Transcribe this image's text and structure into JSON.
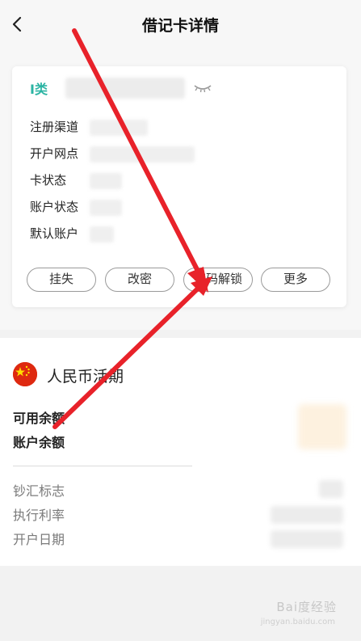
{
  "header": {
    "title": "借记卡详情"
  },
  "card": {
    "class_label": "I类",
    "fields": [
      {
        "label": "注册渠道"
      },
      {
        "label": "开户网点"
      },
      {
        "label": "卡状态"
      },
      {
        "label": "账户状态"
      },
      {
        "label": "默认账户"
      }
    ],
    "actions": [
      {
        "label": "挂失"
      },
      {
        "label": "改密"
      },
      {
        "label": "密码解锁"
      },
      {
        "label": "更多"
      }
    ]
  },
  "account": {
    "currency_title": "人民币活期",
    "available_balance_label": "可用余额",
    "account_balance_label": "账户余额",
    "details": [
      {
        "label": "钞汇标志"
      },
      {
        "label": "执行利率"
      },
      {
        "label": "开户日期"
      }
    ]
  },
  "watermark": {
    "text": "Bai度经验",
    "sub": "jingyan.baidu.com"
  },
  "colors": {
    "accent": "#2bb4a3",
    "arrow": "#e8222a",
    "flag_red": "#de2910",
    "flag_star": "#ffde00"
  }
}
